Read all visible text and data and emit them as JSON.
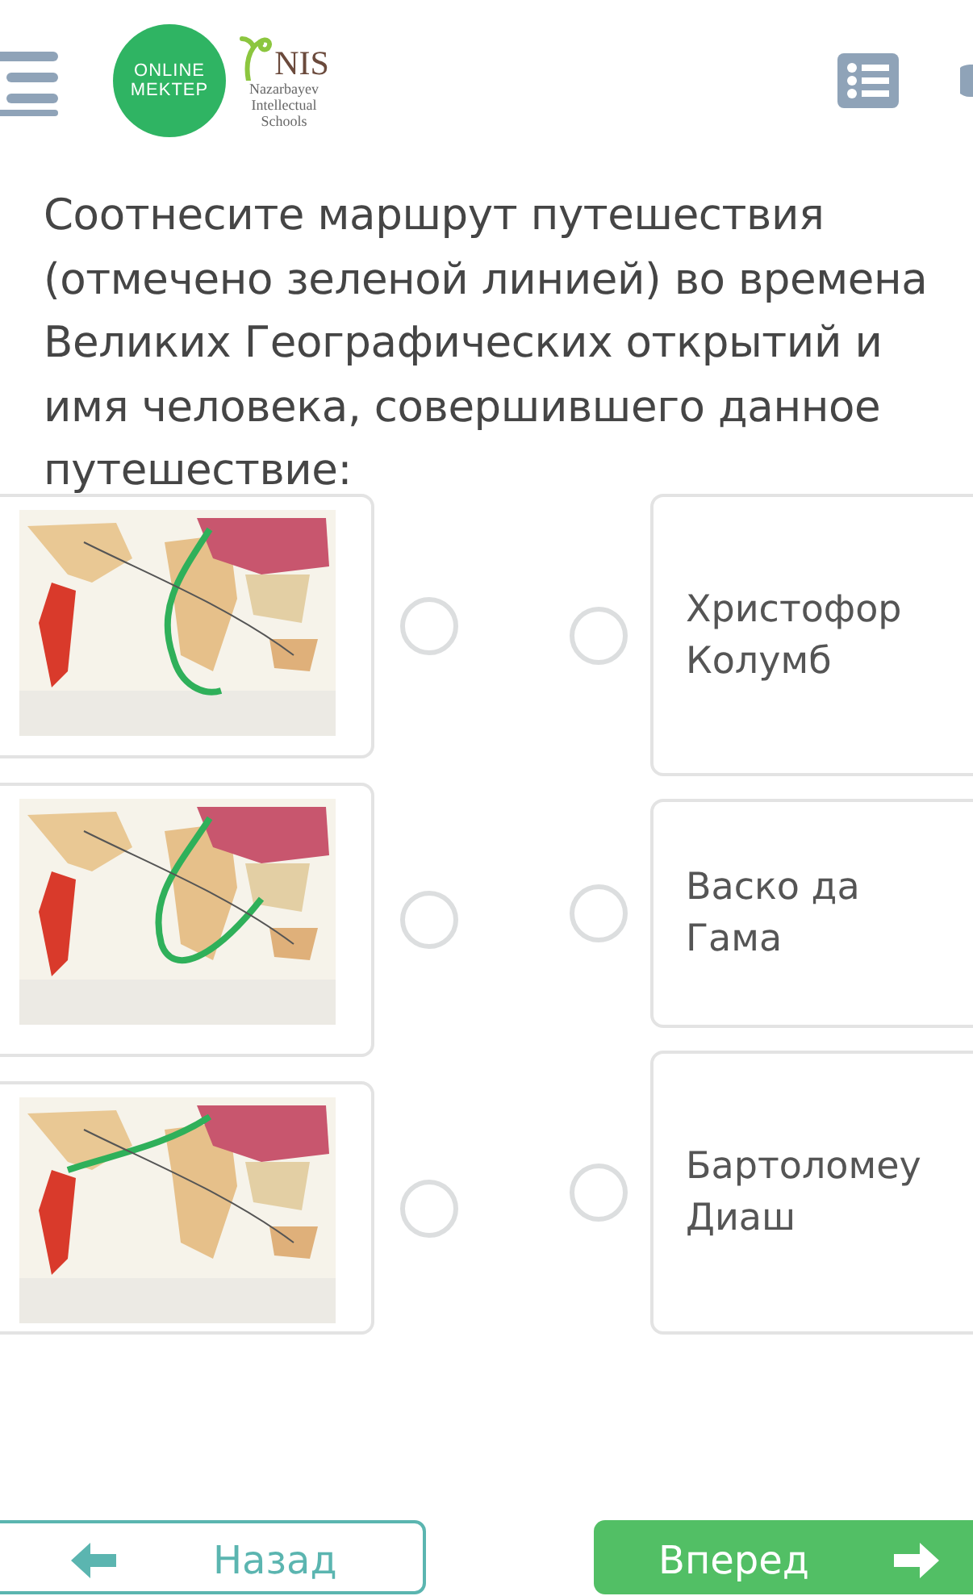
{
  "header": {
    "logo_top": "ONLINE",
    "logo_bottom": "MEKTEP",
    "school_mark": "NIS",
    "school_name": "Nazarbayev Intellectual Schools"
  },
  "question": "Соотнесите маршрут путешествия (отмечено зеленой линией) во времена Великих Географических открытий и имя человека, совершившего данное путешествие:",
  "right_items": [
    {
      "label": "Христофор Колумб",
      "selected": false
    },
    {
      "label": "Васко да Гама",
      "selected": false
    },
    {
      "label": "Бартоломеу Диаш",
      "selected": false
    }
  ],
  "buttons": [
    {
      "kind": "back",
      "label": "Назад"
    },
    {
      "kind": "next",
      "label": "Вперед"
    }
  ]
}
